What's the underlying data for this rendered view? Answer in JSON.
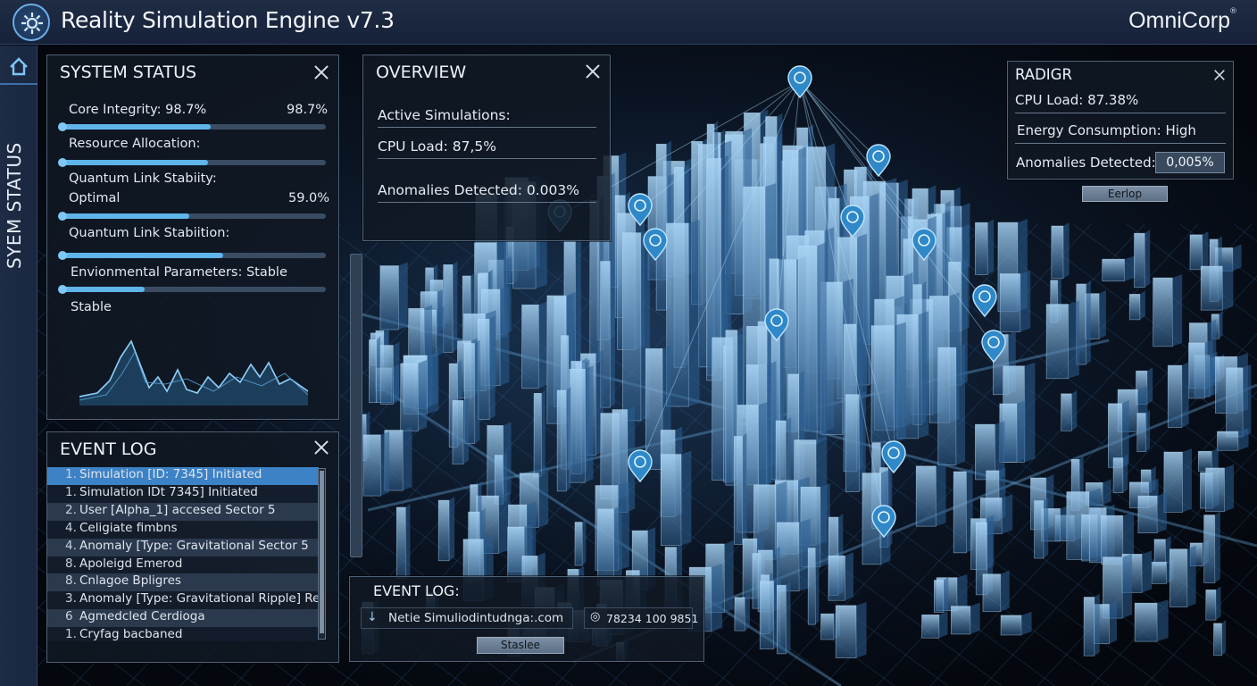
{
  "app": {
    "title": "Reality Simulation Engine v7.3",
    "brand": "OmniCorp",
    "brand_mark": "®",
    "rail_label": "SYEM STATUS",
    "icons": [
      "gear-icon",
      "home-icon",
      "close-icon",
      "download-icon",
      "target-icon",
      "map-pin-icon"
    ]
  },
  "system_status": {
    "title": "SYSTEM STATUS",
    "rows": [
      {
        "label": "Core Integrity:  98.7%",
        "value": "98.7%",
        "level": 0.56
      },
      {
        "label": "Resource Allocation:",
        "value": "",
        "level": 0.55
      },
      {
        "label": "Quantum Link Stabiity:",
        "sublabel": "Optimal",
        "value": "59.0%",
        "level": 0.48
      },
      {
        "label": "Quantum Link Stabiition:",
        "value": "",
        "level": 0.61
      },
      {
        "label": "Envionmental Parameters: Stable",
        "value": "",
        "level": 0.31
      }
    ],
    "footer": "Stable"
  },
  "event_log": {
    "title": "EVENT LOG",
    "items": [
      {
        "num": "1.",
        "text": "Simulation [ID: 7345] Initiated"
      },
      {
        "num": "1.",
        "text": "Simulation IDt 7345] Initiated"
      },
      {
        "num": "2.",
        "text": "User [Alpha_1] accesed Sector 5"
      },
      {
        "num": "4.",
        "text": "Celigiate fimbns"
      },
      {
        "num": "4.",
        "text": "Anomaly [Type: Gravitational Sector 5"
      },
      {
        "num": "8.",
        "text": "Apoleigd Emerod"
      },
      {
        "num": "8.",
        "text": "Cnlagoe Bpligres"
      },
      {
        "num": "3.",
        "text": "Anomaly [Type: Gravitational Ripple] Resolved"
      },
      {
        "num": "6",
        "text": "Agmedcled Cerdioga"
      },
      {
        "num": "1.",
        "text": "Cryfag bacbaned"
      }
    ]
  },
  "overview": {
    "title": "OVERVIEW",
    "lines": [
      "Active Simulations:",
      "CPU Load: 87,5%",
      "Anomalies Detected: 0.003%"
    ]
  },
  "radigr": {
    "title": "RADIGR",
    "cpu": "CPU Load: 87.38%",
    "energy": "Energy Consumption: High",
    "anomalies_label": "Anomalies Detected:",
    "anomalies_value": "0,005%",
    "button": "Eerlop"
  },
  "bottom_log": {
    "title": "EVENT LOG:",
    "field_text": "Netie Simuliodintudnga:.com",
    "id_text": "78234 100 9851",
    "button": "Staslee"
  },
  "colors": {
    "accent": "#5fb4ea",
    "selected_row": "#3d82c6",
    "panel_bg": "#10182499",
    "title_bar": "#1e2c44"
  }
}
